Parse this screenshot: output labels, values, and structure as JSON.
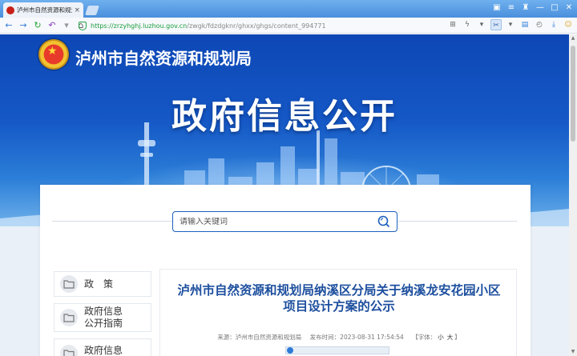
{
  "browser": {
    "tab_title": "泸州市自然资源和规划局",
    "tab_close": "×",
    "url_host": "https://zrzyhghj.luzhou.gov.cn",
    "url_path": "/zwgk/fdzdgknr/ghxx/ghgs/content_994771",
    "accent": "#4a8fdd"
  },
  "header": {
    "site_name": "泸州市自然资源和规划局",
    "hero_title": "政府信息公开"
  },
  "search": {
    "placeholder": "请输入关键词"
  },
  "sidebar": {
    "items": [
      {
        "label": "政策"
      },
      {
        "label_line1": "政府信息",
        "label_line2": "公开指南"
      },
      {
        "label_line1": "政府信息"
      }
    ]
  },
  "article": {
    "title": "泸州市自然资源和规划局纳溪区分局关于纳溪龙安花园小区项目设计方案的公示",
    "source": "来源：泸州市自然资源和规划局",
    "published": "发布时间：2023-08-31 17:54:54",
    "font_size_label": "【字体：",
    "font_small": "小",
    "font_large": "大",
    "font_size_close": "】"
  }
}
